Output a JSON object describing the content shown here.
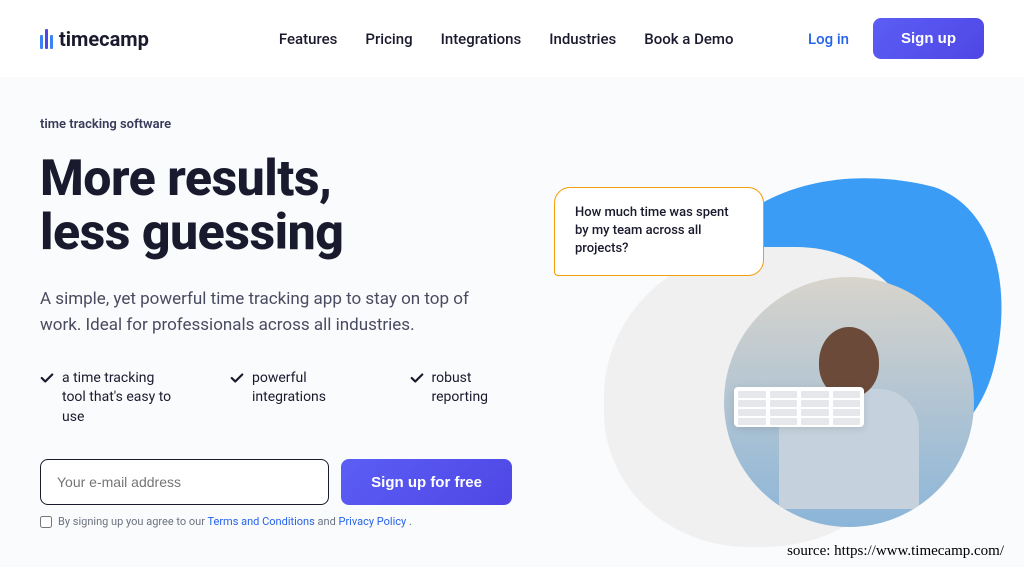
{
  "brand": {
    "name": "timecamp"
  },
  "nav": {
    "items": [
      "Features",
      "Pricing",
      "Integrations",
      "Industries",
      "Book a Demo"
    ]
  },
  "header": {
    "login": "Log in",
    "signup": "Sign up"
  },
  "hero": {
    "eyebrow": "time tracking software",
    "headline_line1": "More results,",
    "headline_line2": "less guessing",
    "subhead": "A simple, yet powerful time tracking app to stay on top of work. Ideal for professionals across all industries.",
    "features": [
      "a time tracking tool that's easy to use",
      "powerful integrations",
      "robust reporting"
    ],
    "email_placeholder": "Your e-mail address",
    "cta": "Sign up for free",
    "terms_prefix": "By signing up you agree to our ",
    "terms_link": "Terms and Conditions",
    "terms_and": " and ",
    "privacy_link": "Privacy Policy",
    "terms_suffix": " ."
  },
  "illustration": {
    "bubble_text": "How much time was spent by my team across all projects?"
  },
  "source": {
    "label": "source:  https://www.timecamp.com/"
  },
  "colors": {
    "primary": "#4f46e5",
    "link": "#2563eb",
    "bubble_border": "#f59e0b"
  }
}
